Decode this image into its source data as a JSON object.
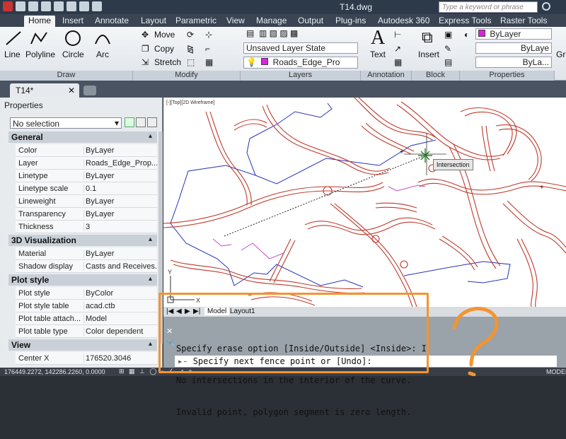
{
  "title_bar": {
    "document_title": "T14.dwg",
    "search_placeholder": "Type a keyword or phrase"
  },
  "ribbon_tabs": [
    "Home",
    "Insert",
    "Annotate",
    "Layout",
    "Parametric",
    "View",
    "Manage",
    "Output",
    "Plug-ins",
    "Autodesk 360",
    "Express Tools",
    "Raster Tools"
  ],
  "ribbon": {
    "draw": {
      "title": "Draw",
      "line": "Line",
      "polyline": "Polyline",
      "circle": "Circle",
      "arc": "Arc"
    },
    "modify": {
      "title": "Modify",
      "move": "Move",
      "copy": "Copy",
      "stretch": "Stretch"
    },
    "layers": {
      "title": "Layers",
      "layer_state": "Unsaved Layer State",
      "current_layer": "Roads_Edge_Pro"
    },
    "annotation": {
      "title": "Annotation",
      "text": "Text"
    },
    "block": {
      "title": "Block",
      "insert": "Insert"
    },
    "properties": {
      "title": "Properties",
      "color": "ByLayer",
      "linetype": "ByLaye",
      "lineweight": "ByLa..."
    },
    "groups_partial": "Gr"
  },
  "doc_tab": "T14*",
  "properties_palette": {
    "title": "Properties",
    "selection": "No selection",
    "sections": [
      {
        "name": "General",
        "rows": [
          {
            "k": "Color",
            "v": "ByLayer"
          },
          {
            "k": "Layer",
            "v": "Roads_Edge_Prop..."
          },
          {
            "k": "Linetype",
            "v": "ByLayer"
          },
          {
            "k": "Linetype scale",
            "v": "0.1"
          },
          {
            "k": "Lineweight",
            "v": "ByLayer"
          },
          {
            "k": "Transparency",
            "v": "ByLayer"
          },
          {
            "k": "Thickness",
            "v": "3"
          }
        ]
      },
      {
        "name": "3D Visualization",
        "rows": [
          {
            "k": "Material",
            "v": "ByLayer"
          },
          {
            "k": "Shadow display",
            "v": "Casts and Receives..."
          }
        ]
      },
      {
        "name": "Plot style",
        "rows": [
          {
            "k": "Plot style",
            "v": "ByColor"
          },
          {
            "k": "Plot style table",
            "v": "acad.ctb"
          },
          {
            "k": "Plot table attach...",
            "v": "Model"
          },
          {
            "k": "Plot table type",
            "v": "Color dependent"
          }
        ]
      },
      {
        "name": "View",
        "rows": [
          {
            "k": "Center X",
            "v": "176520.3046"
          }
        ]
      }
    ]
  },
  "viewport_label": "[-][Top][2D Wireframe]",
  "snap_tooltip": "Intersection",
  "layout_tabs": [
    "Model",
    "Layout1"
  ],
  "command_line": {
    "history": [
      "Specify erase option [Inside/Outside] <Inside>: I",
      "No intersections in the interior of the curve.",
      "Invalid point, polygon segment is zero length."
    ],
    "prompt": "Specify next fence point or [Undo]:"
  },
  "status_bar": {
    "coords": "176449.2272, 142286.2260, 0.0000",
    "right": "MODEL"
  },
  "colors": {
    "accent_orange": "#f39431",
    "road_red": "#c0392b",
    "boundary_blue": "#2533b8",
    "magenta": "#c050c0"
  }
}
